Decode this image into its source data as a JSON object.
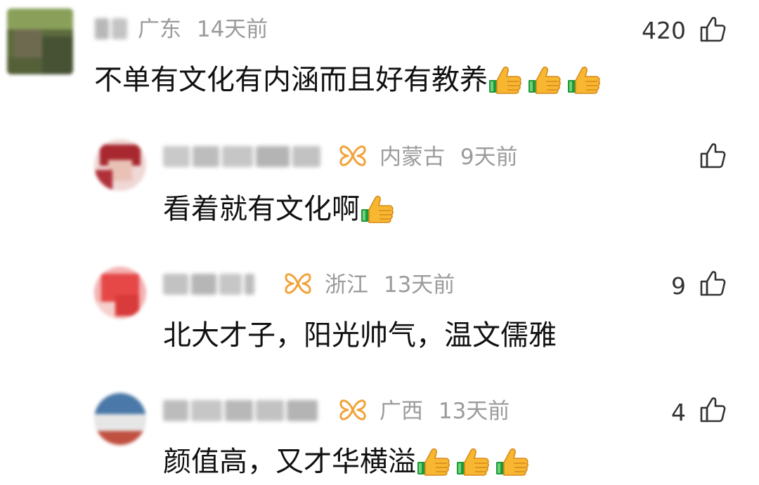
{
  "colors": {
    "text_primary": "#111111",
    "text_meta": "#9b9b9b",
    "vip_accent": "#f2a33a",
    "like_icon": "#333333"
  },
  "comments": [
    {
      "username": "",
      "username_blurred": true,
      "has_vip_badge": false,
      "location": "广东",
      "time": "14天前",
      "text": "不单有文化有内涵而且好有教养",
      "emoji_count": 3,
      "emoji_name": "thumbs-up-emoji",
      "likes": "420"
    },
    {
      "username": "",
      "username_blurred": true,
      "has_vip_badge": true,
      "location": "内蒙古",
      "time": "9天前",
      "text": "看着就有文化啊",
      "emoji_count": 1,
      "emoji_name": "thumbs-up-emoji",
      "likes": ""
    },
    {
      "username": "",
      "username_blurred": true,
      "has_vip_badge": true,
      "location": "浙江",
      "time": "13天前",
      "text": "北大才子，阳光帅气，温文儒雅",
      "emoji_count": 0,
      "emoji_name": "",
      "likes": "9"
    },
    {
      "username": "",
      "username_blurred": true,
      "has_vip_badge": true,
      "location": "广西",
      "time": "13天前",
      "text": "颜值高，又才华横溢",
      "emoji_count": 3,
      "emoji_name": "thumbs-up-emoji",
      "likes": "4"
    }
  ],
  "icons": {
    "like": "thumbs-up-outline-icon",
    "vip": "vip-butterfly-icon"
  }
}
